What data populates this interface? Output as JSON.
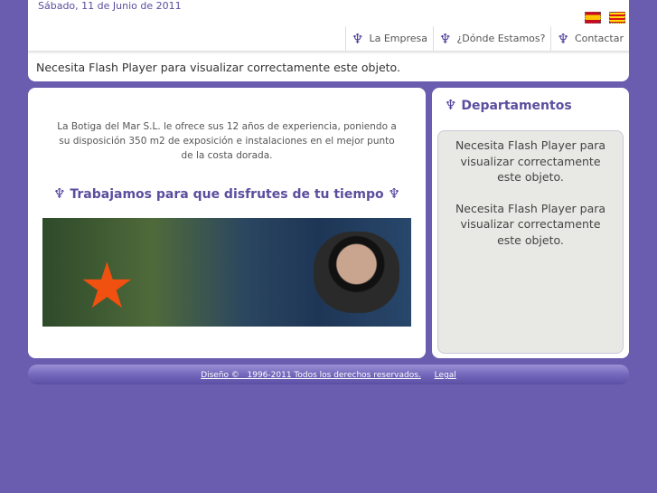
{
  "header": {
    "date": "Sábado, 11 de Junio de 2011",
    "languages": [
      "Español",
      "Català"
    ],
    "menu": [
      {
        "label": "La Empresa",
        "icon": "diver-icon"
      },
      {
        "label": "¿Dónde Estamos?",
        "icon": "diver-icon"
      },
      {
        "label": "Contactar",
        "icon": "diver-icon"
      }
    ],
    "flash_notice": "Necesita Flash Player para visualizar correctamente este objeto."
  },
  "main": {
    "intro": "La Botiga del Mar S.L. le ofrece sus 12 años de experiencia, poniendo a su disposición 350 m2 de exposición e instalaciones en el mejor punto de la costa dorada.",
    "slogan": "Trabajamos para que disfrutes de tu tiempo"
  },
  "sidebar": {
    "title": "Departamentos",
    "flash_1": "Necesita Flash Player para visualizar correctamente este objeto.",
    "flash_2": "Necesita Flash Player para visualizar correctamente este objeto."
  },
  "footer": {
    "copyright": "Diseño ©   1996-2011 Todos los derechos reservados.",
    "legal": "Legal"
  }
}
